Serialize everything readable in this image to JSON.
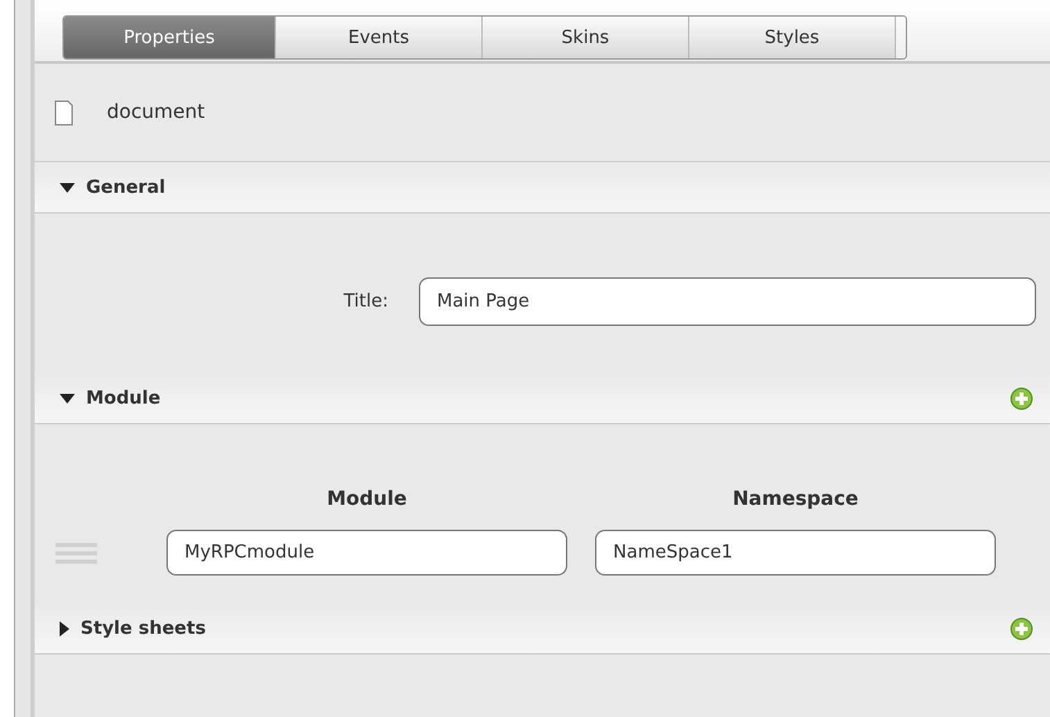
{
  "tabs": [
    {
      "label": "Properties",
      "selected": true
    },
    {
      "label": "Events",
      "selected": false
    },
    {
      "label": "Skins",
      "selected": false
    },
    {
      "label": "Styles",
      "selected": false
    }
  ],
  "object": {
    "label": "document"
  },
  "sections": [
    {
      "kind": "form",
      "title": "General",
      "expanded": true,
      "addable": false,
      "fields": [
        {
          "label": "Title:",
          "value": "Main Page"
        }
      ]
    },
    {
      "kind": "table",
      "title": "Module",
      "expanded": true,
      "addable": true,
      "columns": [
        "Module",
        "Namespace"
      ],
      "rows": [
        [
          "MyRPCmodule",
          "NameSpace1"
        ]
      ]
    },
    {
      "title": "Style sheets",
      "expanded": false,
      "addable": true
    }
  ]
}
